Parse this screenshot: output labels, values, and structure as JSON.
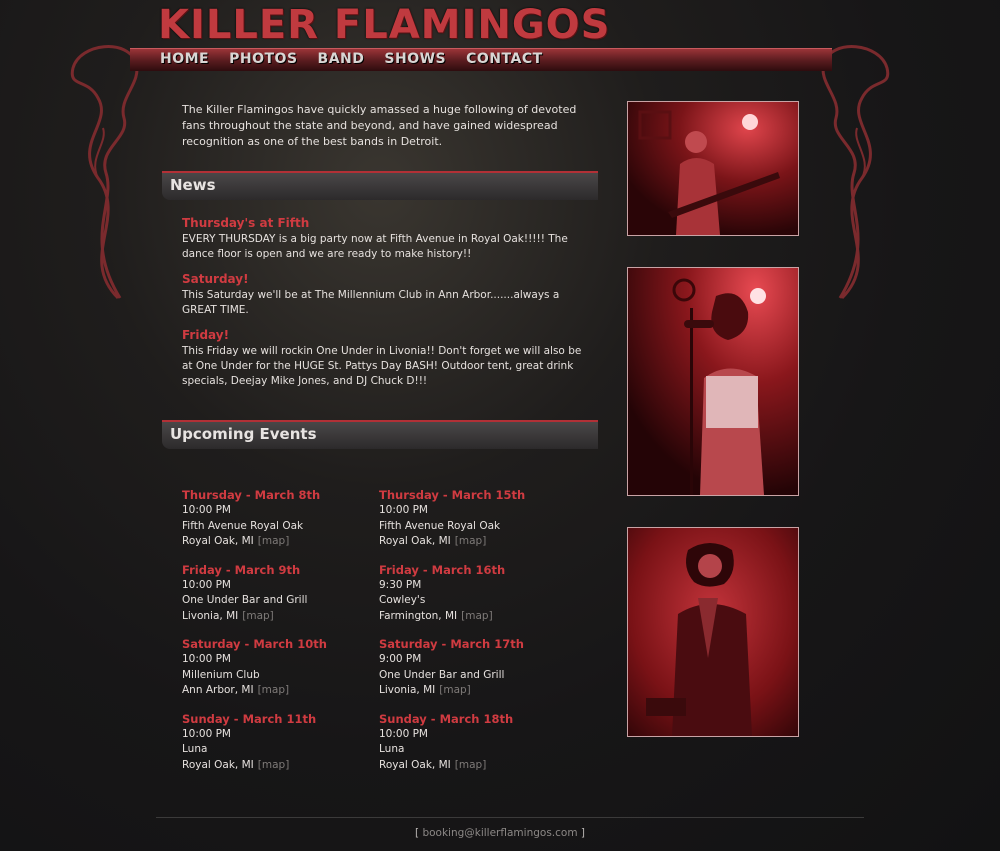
{
  "site": {
    "title": "KILLER FLAMINGOS",
    "accent_color": "#d03b41"
  },
  "nav": {
    "items": [
      "HOME",
      "PHOTOS",
      "BAND",
      "SHOWS",
      "CONTACT"
    ]
  },
  "intro": "The Killer Flamingos have quickly amassed a huge following of devoted fans throughout the state and beyond, and have gained widespread recognition as one of the best bands in Detroit.",
  "news": {
    "heading": "News",
    "items": [
      {
        "title": "Thursday's at Fifth",
        "body": "EVERY THURSDAY is a big party now at Fifth Avenue in Royal Oak!!!!! The dance floor is open and we are ready to make history!!"
      },
      {
        "title": "Saturday!",
        "body": "This Saturday we'll be at The Millennium Club in Ann Arbor.......always a GREAT TIME."
      },
      {
        "title": "Friday!",
        "body": "This Friday we will rockin One Under in Livonia!! Don't forget we will also be at One Under for the HUGE St. Pattys Day BASH! Outdoor tent, great drink specials, Deejay Mike Jones, and DJ Chuck D!!!"
      }
    ]
  },
  "events": {
    "heading": "Upcoming Events",
    "map_label": "[map]",
    "items": [
      {
        "date": "Thursday - March 8th",
        "time": "10:00 PM",
        "venue": "Fifth Avenue Royal Oak",
        "city": "Royal Oak, MI"
      },
      {
        "date": "Thursday - March 15th",
        "time": "10:00 PM",
        "venue": "Fifth Avenue Royal Oak",
        "city": "Royal Oak, MI"
      },
      {
        "date": "Friday - March 9th",
        "time": "10:00 PM",
        "venue": "One Under Bar and Grill",
        "city": "Livonia, MI"
      },
      {
        "date": "Friday - March 16th",
        "time": "9:30 PM",
        "venue": "Cowley's",
        "city": "Farmington, MI"
      },
      {
        "date": "Saturday - March 10th",
        "time": "10:00 PM",
        "venue": "Millenium Club",
        "city": "Ann Arbor, MI"
      },
      {
        "date": "Saturday - March 17th",
        "time": "9:00 PM",
        "venue": "One Under Bar and Grill",
        "city": "Livonia, MI"
      },
      {
        "date": "Sunday - March 11th",
        "time": "10:00 PM",
        "venue": "Luna",
        "city": "Royal Oak, MI"
      },
      {
        "date": "Sunday - March 18th",
        "time": "10:00 PM",
        "venue": "Luna",
        "city": "Royal Oak, MI"
      }
    ]
  },
  "footer": {
    "open_bracket": "[",
    "email": "booking@killerflamingos.com",
    "close_bracket": "]"
  }
}
